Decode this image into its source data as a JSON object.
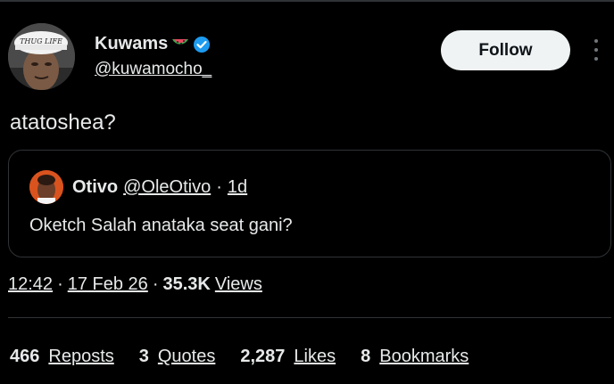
{
  "author": {
    "display_name": "Kuwams",
    "emoji": "🍉",
    "handle": "@kuwamocho_",
    "avatar_cap_text": "THUG LIFE"
  },
  "follow_label": "Follow",
  "tweet_text": "atatoshea?",
  "quote": {
    "name": "Otivo",
    "handle": "@OleOtivo",
    "sep": "·",
    "time": "1d",
    "text": "Oketch Salah anataka seat gani?"
  },
  "meta": {
    "time": "12:42",
    "sep1": "·",
    "date": "17 Feb 26",
    "sep2": "·",
    "views_count": "35.3K",
    "views_label": "Views"
  },
  "stats": [
    {
      "count": "466",
      "label": "Reposts"
    },
    {
      "count": "3",
      "label": "Quotes"
    },
    {
      "count": "2,287",
      "label": "Likes"
    },
    {
      "count": "8",
      "label": "Bookmarks"
    }
  ],
  "colors": {
    "verified": "#1d9bf0",
    "background": "#000000",
    "border": "#2f3336",
    "text": "#e7e9ea",
    "follow_bg": "#eff3f4"
  }
}
